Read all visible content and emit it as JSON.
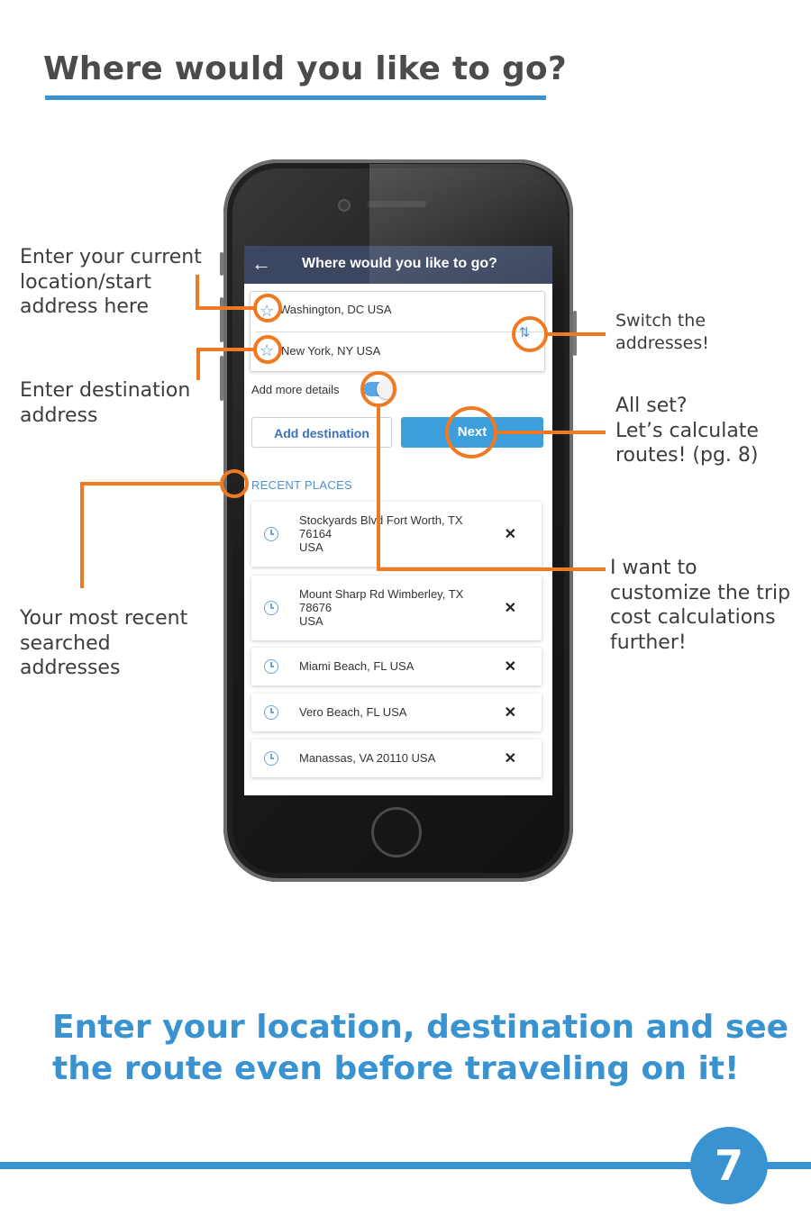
{
  "page": {
    "title": "Where would you like to go?",
    "tagline": "Enter your location, destination and see\nthe route even before traveling on it!",
    "page_number": "7"
  },
  "app": {
    "header_title": "Where would you like to go?",
    "start_address": "Washington, DC USA",
    "destination_address": "New York, NY USA",
    "add_details_label": "Add more details",
    "add_details_toggle_on": true,
    "add_destination_label": "Add destination",
    "next_label": "Next",
    "recent_header": "RECENT PLACES",
    "recent_places": [
      "Stockyards Blvd Fort Worth, TX\n76164\nUSA",
      "Mount Sharp Rd Wimberley, TX\n78676\nUSA",
      "Miami Beach, FL USA",
      "Vero Beach, FL USA",
      "Manassas, VA 20110 USA"
    ],
    "remove_glyph": "✕"
  },
  "callouts": {
    "start": "Enter your current\nlocation/start\naddress here",
    "destination": "Enter destination\naddress",
    "recent": "Your most recent\nsearched\naddresses",
    "swap": "Switch the\naddresses!",
    "next": "All set?\nLet’s calculate\nroutes! (pg. 8)",
    "details": "I want to\ncustomize the trip\ncost calculations\nfurther!"
  },
  "colors": {
    "accent_blue": "#3a93d1",
    "callout_orange": "#f07a22",
    "app_bar": "#3b4660"
  },
  "icons": {
    "back": "arrow-left-icon",
    "star": "star-outline-icon",
    "swap": "swap-vertical-icon",
    "clock": "clock-icon",
    "remove": "close-icon"
  }
}
